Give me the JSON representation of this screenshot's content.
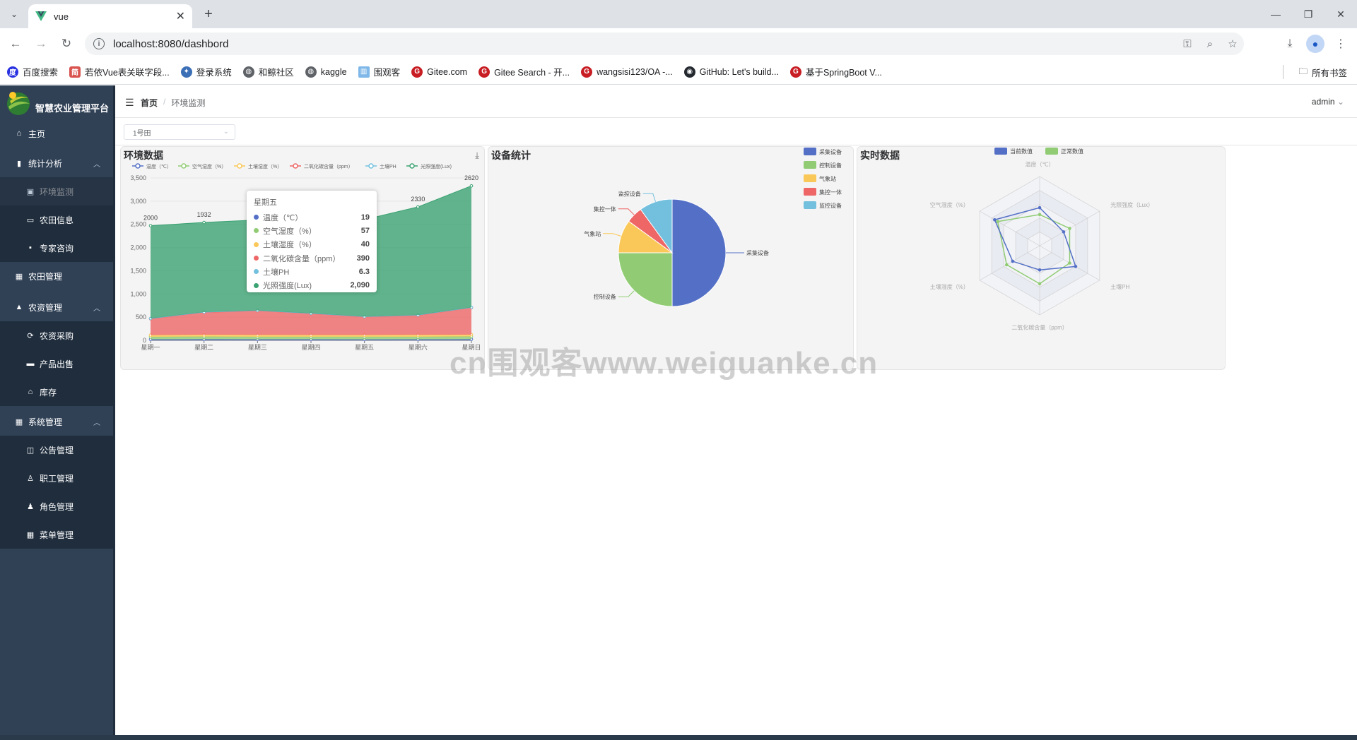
{
  "browser": {
    "tab_title": "vue",
    "url": "localhost:8080/dashbord",
    "bookmarks": [
      "百度搜索",
      "若依Vue表关联字段...",
      "登录系统",
      "和鲸社区",
      "kaggle",
      "围观客",
      "Gitee.com",
      "Gitee Search - 开...",
      "wangsisi123/OA -...",
      "GitHub: Let's build...",
      "基于SpringBoot V..."
    ],
    "all_bookmarks": "所有书签"
  },
  "sidebar": {
    "logo_text": "智慧农业管理平台",
    "items": [
      {
        "label": "主页",
        "icon": "home-icon"
      },
      {
        "label": "统计分析",
        "icon": "chart-icon"
      },
      {
        "label": "环境监测",
        "icon": "monitor-icon"
      },
      {
        "label": "农田信息",
        "icon": "field-icon"
      },
      {
        "label": "专家咨询",
        "icon": "chat-icon"
      },
      {
        "label": "农田管理",
        "icon": "grid-icon"
      },
      {
        "label": "农资管理",
        "icon": "lock-icon"
      },
      {
        "label": "农资采购",
        "icon": "purchase-icon"
      },
      {
        "label": "产品出售",
        "icon": "shop-icon"
      },
      {
        "label": "库存",
        "icon": "home-icon"
      },
      {
        "label": "系统管理",
        "icon": "grid-icon"
      },
      {
        "label": "公告管理",
        "icon": "notice-icon"
      },
      {
        "label": "职工管理",
        "icon": "user-icon"
      },
      {
        "label": "角色管理",
        "icon": "role-icon"
      },
      {
        "label": "菜单管理",
        "icon": "grid-icon"
      }
    ]
  },
  "navbar": {
    "breadcrumb_home": "首页",
    "breadcrumb_sep": "/",
    "breadcrumb_current": "环境监测",
    "user": "admin"
  },
  "field_selector": {
    "value": "1号田"
  },
  "cards": {
    "env": {
      "title": "环境数据"
    },
    "device": {
      "title": "设备统计"
    },
    "realtime": {
      "title": "实时数据"
    }
  },
  "tooltip": {
    "title": "星期五",
    "rows": [
      {
        "label": "温度（℃）",
        "value": "19",
        "color": "#5470c6"
      },
      {
        "label": "空气湿度（%）",
        "value": "57",
        "color": "#91cc75"
      },
      {
        "label": "土壤湿度（%）",
        "value": "40",
        "color": "#fac858"
      },
      {
        "label": "二氧化碳含量（ppm）",
        "value": "390",
        "color": "#ee6666"
      },
      {
        "label": "土壤PH",
        "value": "6.3",
        "color": "#73c0de"
      },
      {
        "label": "光照强度(Lux)",
        "value": "2,090",
        "color": "#3ba272"
      }
    ]
  },
  "watermark": "cn围观客www.weiguanke.cn",
  "chart_data": [
    {
      "type": "area",
      "title": "环境数据",
      "categories": [
        "星期一",
        "星期二",
        "星期三",
        "星期四",
        "星期五",
        "星期六",
        "星期日"
      ],
      "ylim": [
        0,
        3500
      ],
      "yticks": [
        "0",
        "500",
        "1,000",
        "1,500",
        "2,000",
        "2,500",
        "3,000",
        "3,500"
      ],
      "stacked": true,
      "series": [
        {
          "name": "温度（℃）",
          "color": "#5470c6",
          "values": [
            20,
            22,
            21,
            20,
            19,
            21,
            22
          ]
        },
        {
          "name": "空气湿度（%）",
          "color": "#91cc75",
          "values": [
            55,
            58,
            56,
            57,
            57,
            56,
            60
          ]
        },
        {
          "name": "土壤湿度（%）",
          "color": "#fac858",
          "values": [
            40,
            42,
            41,
            39,
            40,
            42,
            41
          ]
        },
        {
          "name": "二氧化碳含量（ppm）",
          "color": "#ee6666",
          "values": [
            350,
            480,
            520,
            460,
            390,
            420,
            580
          ]
        },
        {
          "name": "土壤PH",
          "color": "#73c0de",
          "values": [
            6.5,
            6.4,
            6.2,
            6.3,
            6.3,
            6.4,
            6.5
          ]
        },
        {
          "name": "光照强度(Lux)",
          "color": "#3ba272",
          "values": [
            2000,
            1932,
            1950,
            2050,
            2090,
            2330,
            2620
          ]
        }
      ],
      "point_labels": [
        "2000",
        "1932",
        "",
        "",
        "",
        "2330",
        "2620"
      ],
      "legend_position": "top"
    },
    {
      "type": "pie",
      "title": "设备统计",
      "slices": [
        {
          "name": "采集设备",
          "value": 50,
          "color": "#5470c6"
        },
        {
          "name": "控制设备",
          "value": 25,
          "color": "#91cc75"
        },
        {
          "name": "气象站",
          "value": 10,
          "color": "#fac858"
        },
        {
          "name": "集控一体",
          "value": 5,
          "color": "#ee6666"
        },
        {
          "name": "监控设备",
          "value": 10,
          "color": "#73c0de"
        }
      ],
      "legend_position": "top-right"
    },
    {
      "type": "radar",
      "title": "实时数据",
      "indicators": [
        "温度（℃）",
        "光照强度（Lux）",
        "土壤PH",
        "二氧化碳含量（ppm）",
        "土壤湿度（%）",
        "空气湿度（%）"
      ],
      "series": [
        {
          "name": "当前数值",
          "color": "#5470c6",
          "values": [
            0.55,
            0.4,
            0.6,
            0.35,
            0.45,
            0.75
          ]
        },
        {
          "name": "正常数值",
          "color": "#91cc75",
          "values": [
            0.45,
            0.5,
            0.5,
            0.55,
            0.55,
            0.7
          ]
        }
      ],
      "legend_position": "top"
    }
  ]
}
